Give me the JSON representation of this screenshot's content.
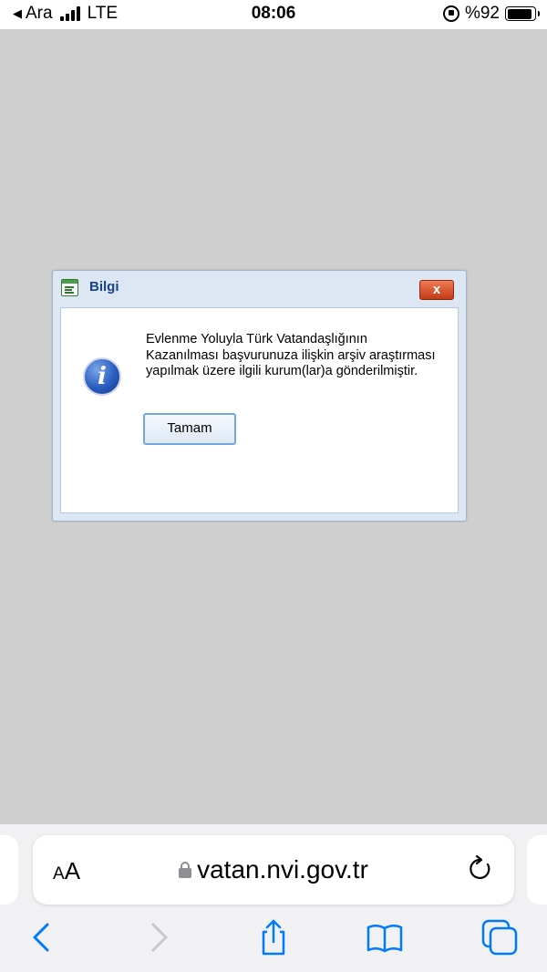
{
  "status_bar": {
    "back_app": "Ara",
    "network": "LTE",
    "time": "08:06",
    "battery_text": "%92",
    "battery_level": 0.92,
    "icons": [
      "back-arrow-icon",
      "signal-bars-icon",
      "rotation-lock-icon",
      "battery-icon"
    ]
  },
  "dialog": {
    "title": "Bilgi",
    "close_label": "x",
    "message": "Evlenme Yoluyla Türk Vatandaşlığının Kazanılması başvurunuza ilişkin arşiv araştırması yapılmak üzere ilgili kurum(lar)a gönderilmiştir.",
    "ok_label": "Tamam",
    "icons": [
      "window-icon",
      "info-icon",
      "close-icon"
    ]
  },
  "browser": {
    "text_size_label_small": "A",
    "text_size_label_big": "A",
    "url": "vatan.nvi.gov.tr",
    "toolbar_icons": [
      "back-icon",
      "forward-icon",
      "share-icon",
      "bookmarks-icon",
      "tabs-icon"
    ]
  },
  "colors": {
    "page_background": "#cfcfcf",
    "dialog_title": "#15428b",
    "close_button": "#d9532c",
    "ios_blue": "#007aff",
    "disabled_gray": "#c7c7cc"
  }
}
